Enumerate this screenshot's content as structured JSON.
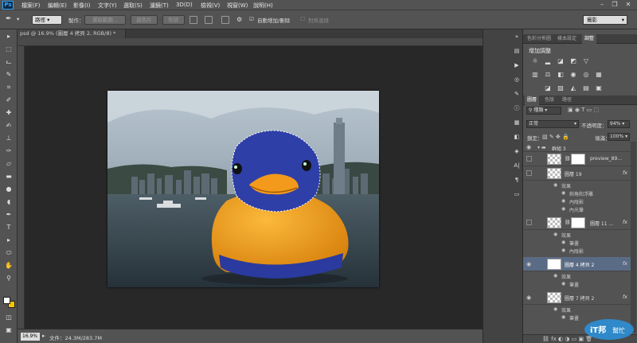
{
  "app": {
    "logo": "Ps"
  },
  "menu": [
    "檔案(F)",
    "編輯(E)",
    "影像(I)",
    "文字(Y)",
    "選取(S)",
    "濾鏡(T)",
    "3D(D)",
    "檢視(V)",
    "視窗(W)",
    "說明(H)"
  ],
  "options": {
    "mode_select": "路徑",
    "make_label": "製作：",
    "select_btn": "選取範圍...",
    "mask_btn": "遮色片",
    "shape_btn": "形狀",
    "auto_add_delete": "自動增加/刪除",
    "align_edges": "對齊邊緣",
    "workspace": "攝影"
  },
  "document": {
    "tab_title": "psd @ 16.9% (圖層 4 拷貝 2, RGB/8) *"
  },
  "status": {
    "zoom": "16.9%",
    "doc_size": "文件：24.3M/283.7M"
  },
  "panels": {
    "top_tabs": [
      "色彩分佈圖",
      "樣本設定",
      "調整"
    ],
    "adjustments_title": "增加調整",
    "layer_tabs": [
      "圖層",
      "色版",
      "路徑"
    ],
    "filter_kind": "種類",
    "blend_mode": "正常",
    "opacity_label": "不透明度：",
    "opacity": "94%",
    "lock_label": "鎖定：",
    "fill_label": "填滿：",
    "fill": "100%",
    "layers": [
      {
        "name": "群組 3",
        "type": "group"
      },
      {
        "name": "preview_89...",
        "type": "layer"
      },
      {
        "name": "圖層 19",
        "type": "layer",
        "fx": "fx",
        "effects_label": "效果",
        "effects": [
          "斜角和浮雕",
          "內陰影",
          "內光暈"
        ]
      },
      {
        "name": "圖層 11 ...",
        "type": "layer",
        "fx": "fx",
        "effects_label": "效果",
        "effects": [
          "筆畫",
          "內陰影"
        ]
      },
      {
        "name": "圖層 4 拷貝 2",
        "type": "layer",
        "fx": "fx",
        "effects_label": "效果",
        "effects": [
          "筆畫"
        ]
      },
      {
        "name": "圖層 7 拷貝 2",
        "type": "layer",
        "fx": "fx",
        "effects_label": "效果",
        "effects": [
          "筆畫"
        ]
      }
    ]
  },
  "colors": {
    "foreground": "#ffffff",
    "background": "#f2c500",
    "selection": "#2a3a9e",
    "duck": "#f0a11f"
  },
  "watermark": {
    "text1": "iT邦",
    "text2": "幫忙"
  }
}
